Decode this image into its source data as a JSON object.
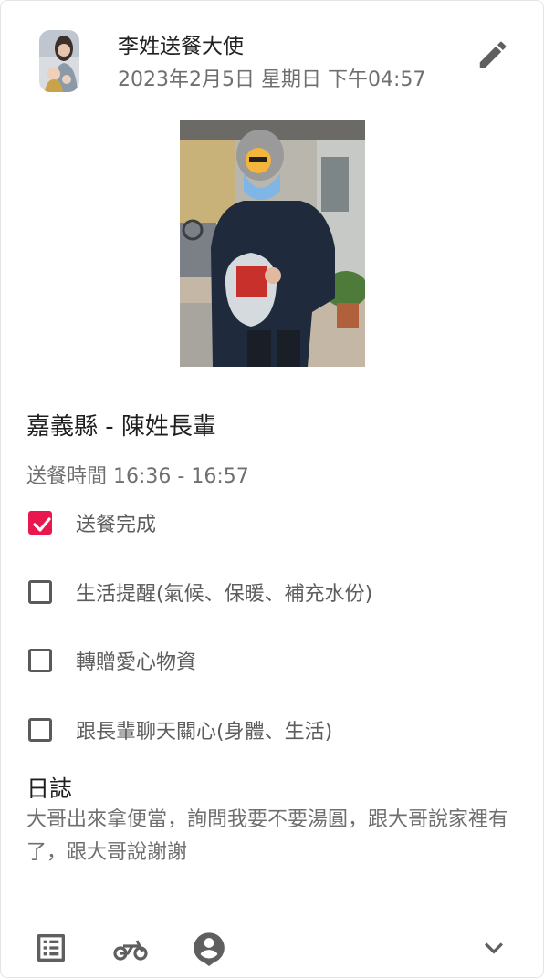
{
  "post": {
    "author": "李姓送餐大使",
    "datetime": "2023年2月5日 星期日 下午04:57"
  },
  "delivery": {
    "recipient": "嘉義縣 - 陳姓長輩",
    "time": "送餐時間 16:36 - 16:57"
  },
  "tasks": [
    {
      "label": "送餐完成",
      "checked": true
    },
    {
      "label": "生活提醒(氣候、保暖、補充水份)",
      "checked": false
    },
    {
      "label": "轉贈愛心物資",
      "checked": false
    },
    {
      "label": "跟長輩聊天關心(身體、生活)",
      "checked": false
    }
  ],
  "log": {
    "title": "日誌",
    "text": "大哥出來拿便當，詢問我要不要湯圓，跟大哥說家裡有了，跟大哥說謝謝"
  },
  "icons": {
    "edit": "pencil-icon",
    "list": "list-icon",
    "scooter": "scooter-icon",
    "location": "person-pin-icon",
    "expand": "chevron-down-icon"
  },
  "colors": {
    "accent": "#e8174d",
    "icon": "#5f5f5f",
    "secondary_text": "#6f6f6f"
  }
}
